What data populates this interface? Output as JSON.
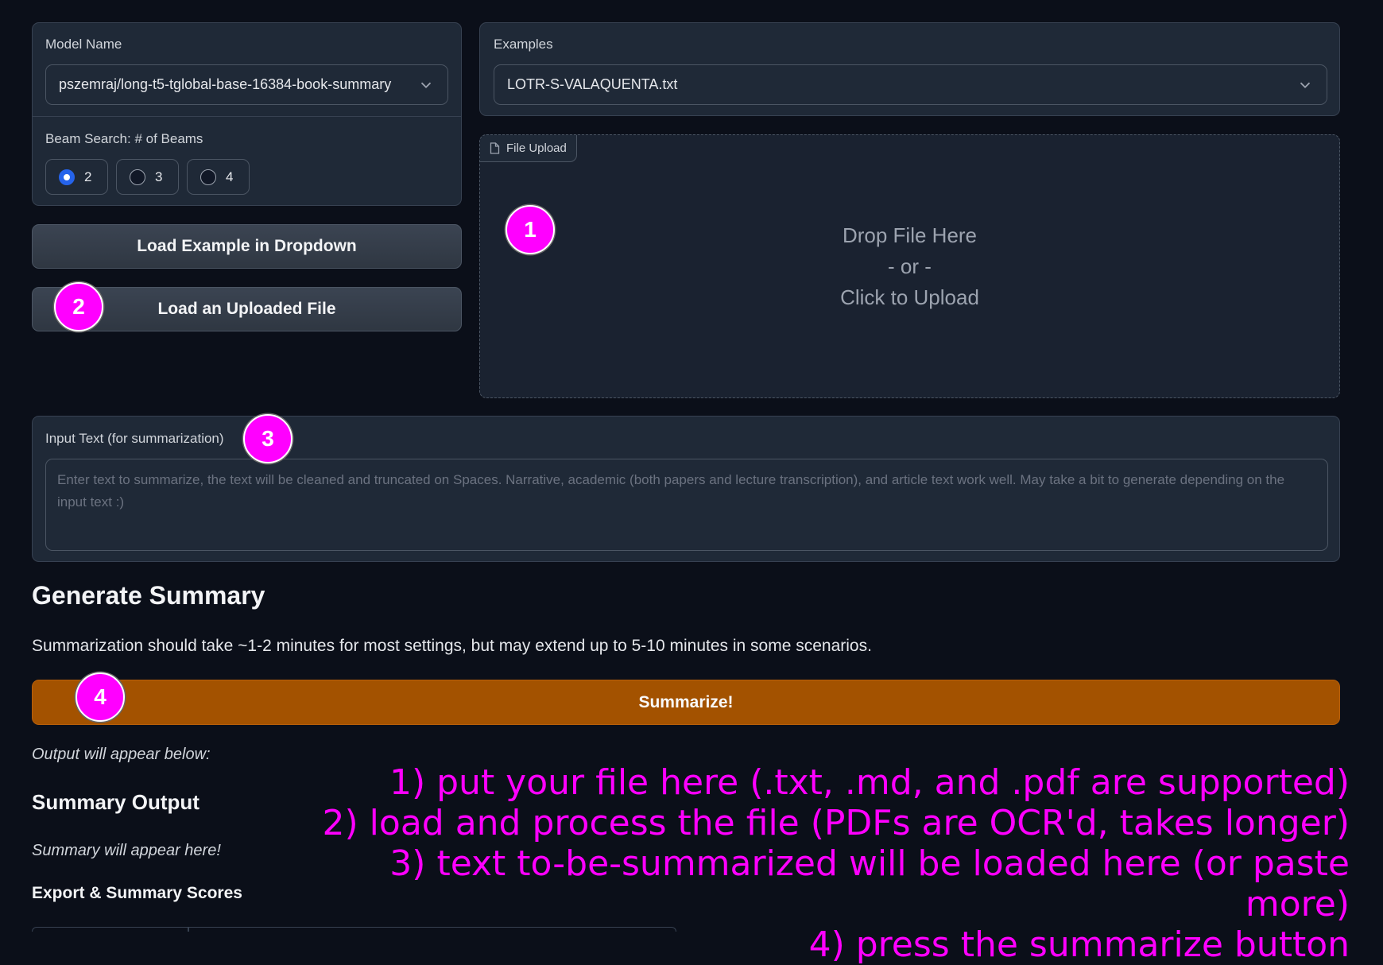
{
  "model": {
    "label": "Model Name",
    "value": "pszemraj/long-t5-tglobal-base-16384-book-summary"
  },
  "beams": {
    "label": "Beam Search: # of Beams",
    "options": [
      "2",
      "3",
      "4"
    ],
    "selected": "2"
  },
  "examples": {
    "label": "Examples",
    "value": "LOTR-S-VALAQUENTA.txt"
  },
  "buttons": {
    "load_example": "Load Example in Dropdown",
    "load_uploaded": "Load an Uploaded File",
    "summarize": "Summarize!"
  },
  "upload": {
    "tab_label": "File Upload",
    "drop_line1": "Drop File Here",
    "drop_line2": "- or -",
    "drop_line3": "Click to Upload"
  },
  "input": {
    "label": "Input Text (for summarization)",
    "placeholder": "Enter text to summarize, the text will be cleaned and truncated on Spaces. Narrative, academic (both papers and lecture transcription), and article text work well. May take a bit to generate depending on the input text :)"
  },
  "generate": {
    "heading": "Generate Summary",
    "note": "Summarization should take ~1-2 minutes for most settings, but may extend up to 5-10 minutes in some scenarios."
  },
  "output": {
    "note": "Output will appear below:",
    "heading": "Summary Output",
    "placeholder": "Summary will appear here!",
    "export_heading": "Export & Summary Scores"
  },
  "markers": [
    "1",
    "2",
    "3",
    "4"
  ],
  "annotations": [
    "1) put your file here (.txt, .md, and .pdf are supported)",
    "2) load and process the file (PDFs are OCR'd, takes longer)",
    "3) text to-be-summarized will be loaded here (or paste more)",
    "4) press the summarize button"
  ],
  "colors": {
    "background": "#0b0f19",
    "panel": "#1f2937",
    "summarize_button": "#a35200",
    "marker": "#ff00ff",
    "radio_accent": "#2563eb"
  },
  "icons": [
    "chevron-down-icon",
    "file-icon"
  ]
}
